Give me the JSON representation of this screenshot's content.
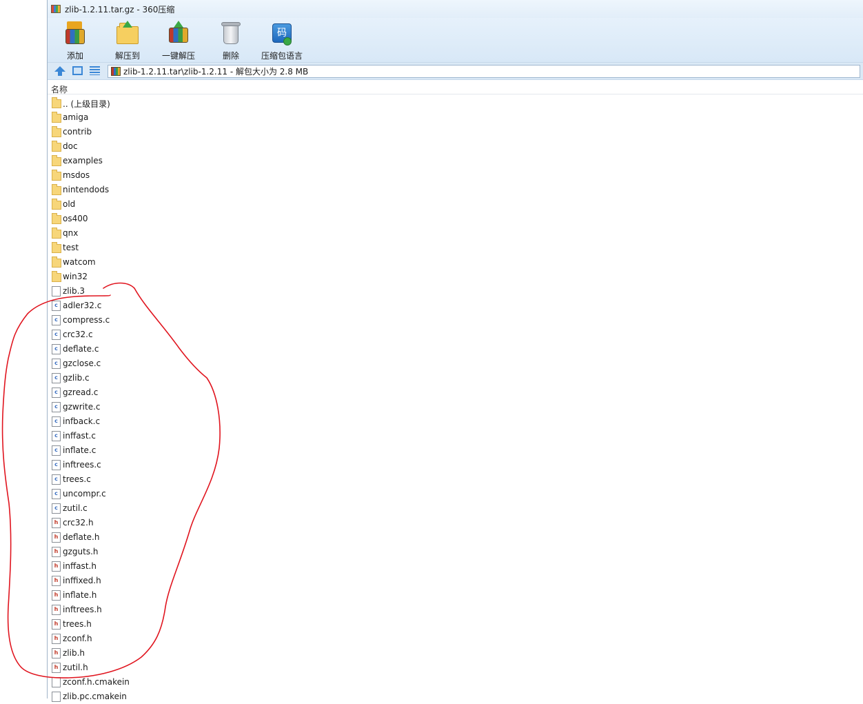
{
  "window": {
    "title": "zlib-1.2.11.tar.gz - 360压缩"
  },
  "toolbar": {
    "buttons": [
      {
        "label": "添加",
        "icon": "add-archive-icon"
      },
      {
        "label": "解压到",
        "icon": "extract-to-icon"
      },
      {
        "label": "一键解压",
        "icon": "one-click-extract-icon"
      },
      {
        "label": "删除",
        "icon": "trash-icon"
      },
      {
        "label": "压缩包语言",
        "icon": "archive-language-icon",
        "glyph": "码"
      }
    ]
  },
  "addressbar": {
    "path": "zlib-1.2.11.tar\\zlib-1.2.11 - 解包大小为 2.8 MB"
  },
  "list": {
    "column_name": "名称",
    "files": [
      {
        "name": ".. (上级目录)",
        "type": "folder"
      },
      {
        "name": "amiga",
        "type": "folder"
      },
      {
        "name": "contrib",
        "type": "folder"
      },
      {
        "name": "doc",
        "type": "folder"
      },
      {
        "name": "examples",
        "type": "folder"
      },
      {
        "name": "msdos",
        "type": "folder"
      },
      {
        "name": "nintendods",
        "type": "folder"
      },
      {
        "name": "old",
        "type": "folder"
      },
      {
        "name": "os400",
        "type": "folder"
      },
      {
        "name": "qnx",
        "type": "folder"
      },
      {
        "name": "test",
        "type": "folder"
      },
      {
        "name": "watcom",
        "type": "folder"
      },
      {
        "name": "win32",
        "type": "folder"
      },
      {
        "name": "zlib.3",
        "type": "doc"
      },
      {
        "name": "adler32.c",
        "type": "c"
      },
      {
        "name": "compress.c",
        "type": "c"
      },
      {
        "name": "crc32.c",
        "type": "c"
      },
      {
        "name": "deflate.c",
        "type": "c"
      },
      {
        "name": "gzclose.c",
        "type": "c"
      },
      {
        "name": "gzlib.c",
        "type": "c"
      },
      {
        "name": "gzread.c",
        "type": "c"
      },
      {
        "name": "gzwrite.c",
        "type": "c"
      },
      {
        "name": "infback.c",
        "type": "c"
      },
      {
        "name": "inffast.c",
        "type": "c"
      },
      {
        "name": "inflate.c",
        "type": "c"
      },
      {
        "name": "inftrees.c",
        "type": "c"
      },
      {
        "name": "trees.c",
        "type": "c"
      },
      {
        "name": "uncompr.c",
        "type": "c"
      },
      {
        "name": "zutil.c",
        "type": "c"
      },
      {
        "name": "crc32.h",
        "type": "h"
      },
      {
        "name": "deflate.h",
        "type": "h"
      },
      {
        "name": "gzguts.h",
        "type": "h"
      },
      {
        "name": "inffast.h",
        "type": "h"
      },
      {
        "name": "inffixed.h",
        "type": "h"
      },
      {
        "name": "inflate.h",
        "type": "h"
      },
      {
        "name": "inftrees.h",
        "type": "h"
      },
      {
        "name": "trees.h",
        "type": "h"
      },
      {
        "name": "zconf.h",
        "type": "h"
      },
      {
        "name": "zlib.h",
        "type": "h"
      },
      {
        "name": "zutil.h",
        "type": "h"
      },
      {
        "name": "zconf.h.cmakein",
        "type": "doc"
      },
      {
        "name": "zlib.pc.cmakein",
        "type": "doc"
      }
    ]
  },
  "colors": {
    "annotation": "#e0141e",
    "accent": "#3b87d6"
  }
}
